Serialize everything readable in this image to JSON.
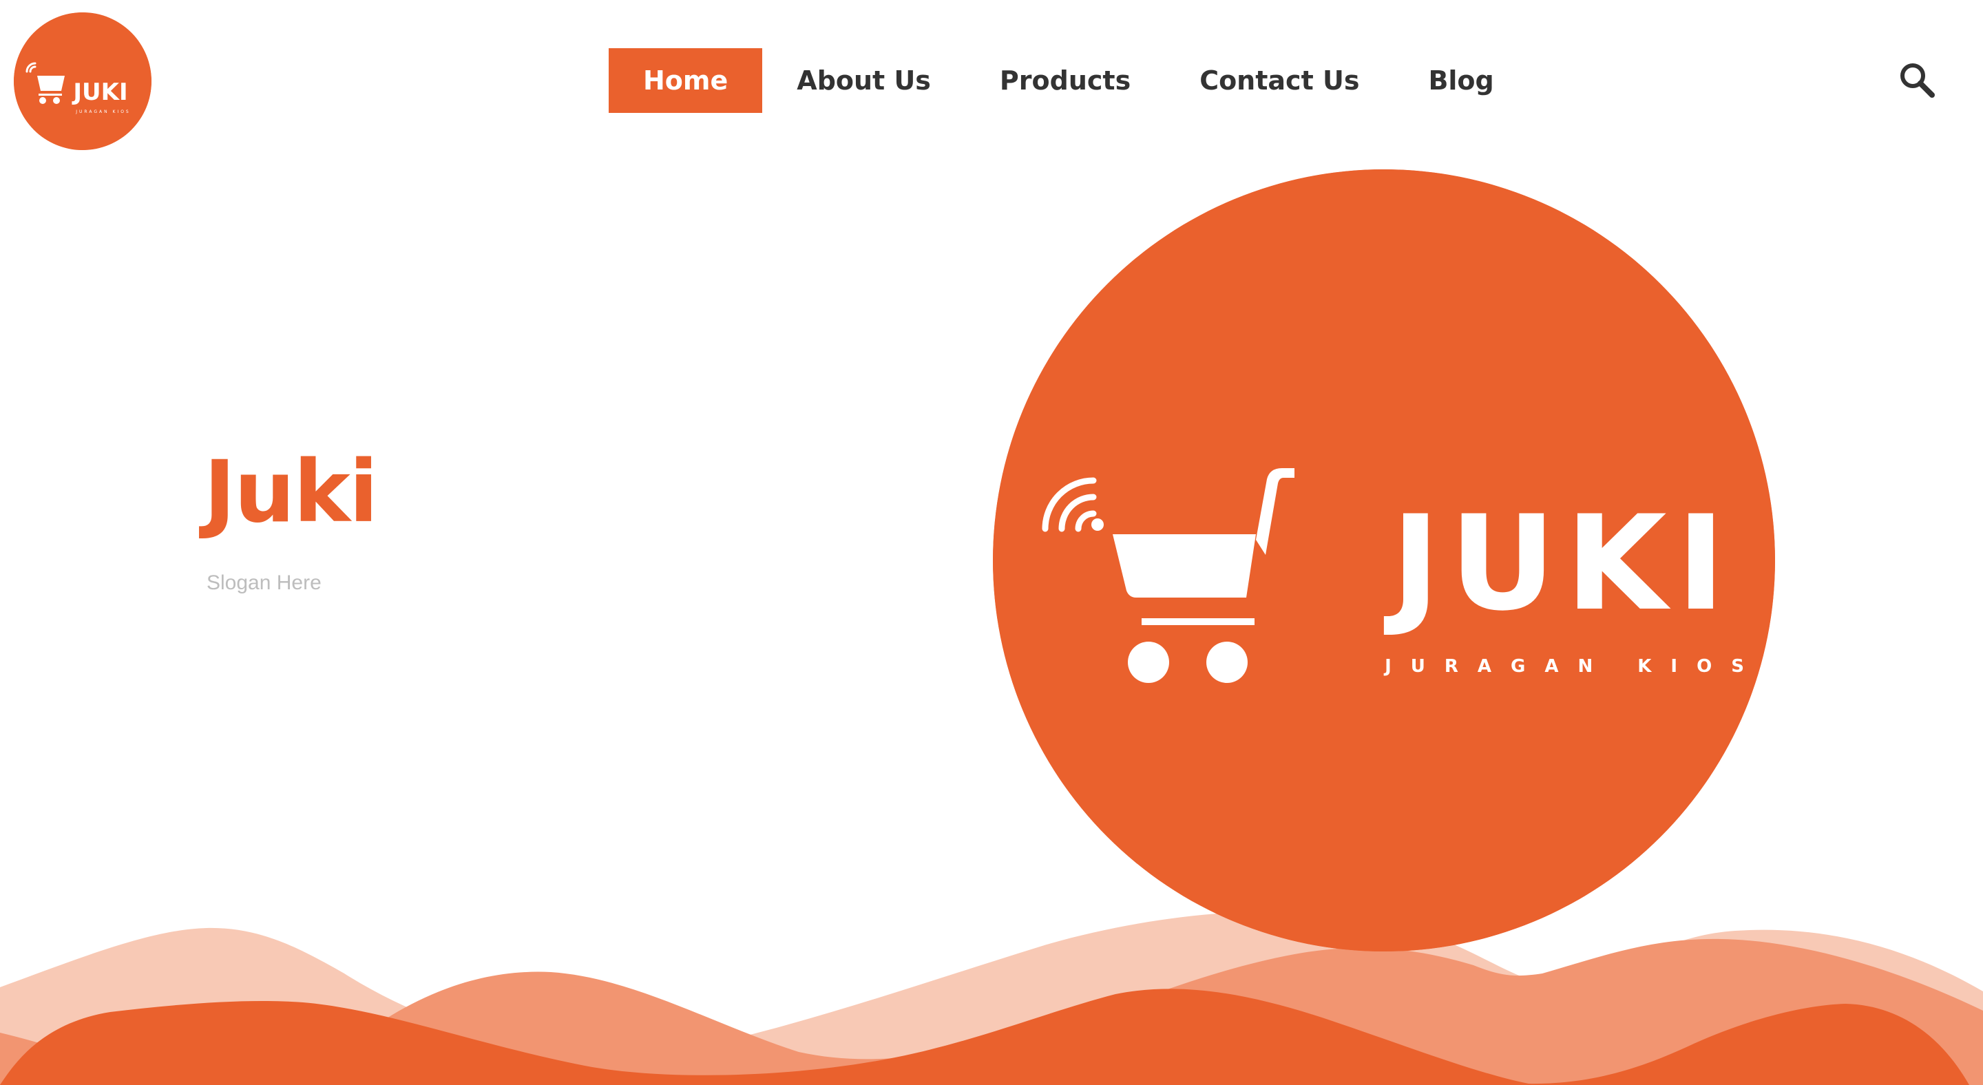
{
  "brand": {
    "logo_wordmark": "JUKI",
    "logo_tagline": "JURAGAN KIOS",
    "accent_color": "#ea612d"
  },
  "nav": {
    "items": [
      {
        "label": "Home",
        "active": true
      },
      {
        "label": "About Us",
        "active": false
      },
      {
        "label": "Products",
        "active": false
      },
      {
        "label": "Contact Us",
        "active": false
      },
      {
        "label": "Blog",
        "active": false
      }
    ]
  },
  "header": {
    "search_icon": "search-icon"
  },
  "hero": {
    "title": "Juki",
    "slogan": "Slogan Here"
  },
  "colors": {
    "wave_light": "#f8c9b5",
    "wave_mid": "#f29571",
    "wave_dark": "#ea612d",
    "nav_text": "#333333",
    "slogan_text": "#bdbdbd"
  }
}
